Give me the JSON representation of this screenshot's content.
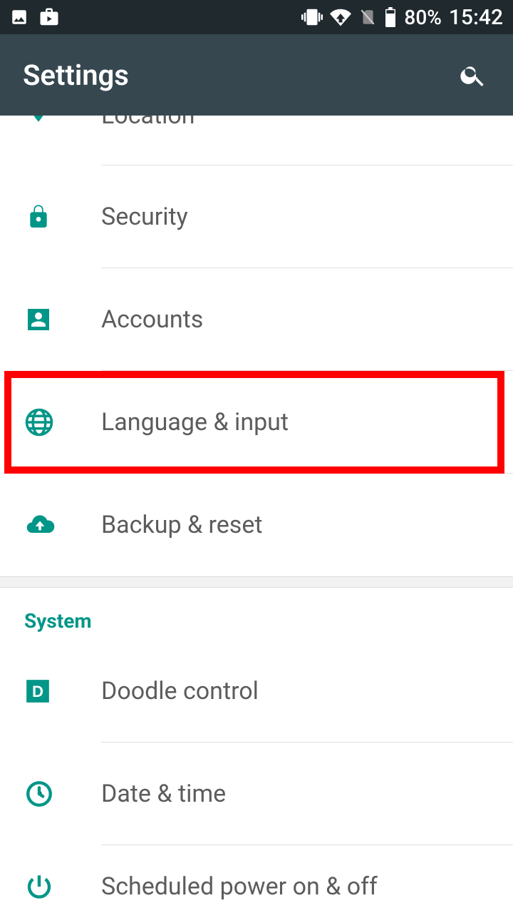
{
  "status": {
    "battery_pct": "80%",
    "clock": "15:42"
  },
  "header": {
    "title": "Settings"
  },
  "items": {
    "location": {
      "label": "Location"
    },
    "security": {
      "label": "Security"
    },
    "accounts": {
      "label": "Accounts"
    },
    "language": {
      "label": "Language & input"
    },
    "backup": {
      "label": "Backup & reset"
    },
    "doodle": {
      "label": "Doodle control"
    },
    "datetime": {
      "label": "Date & time"
    },
    "scheduled": {
      "label": "Scheduled power on & off"
    }
  },
  "section": {
    "system": "System"
  }
}
